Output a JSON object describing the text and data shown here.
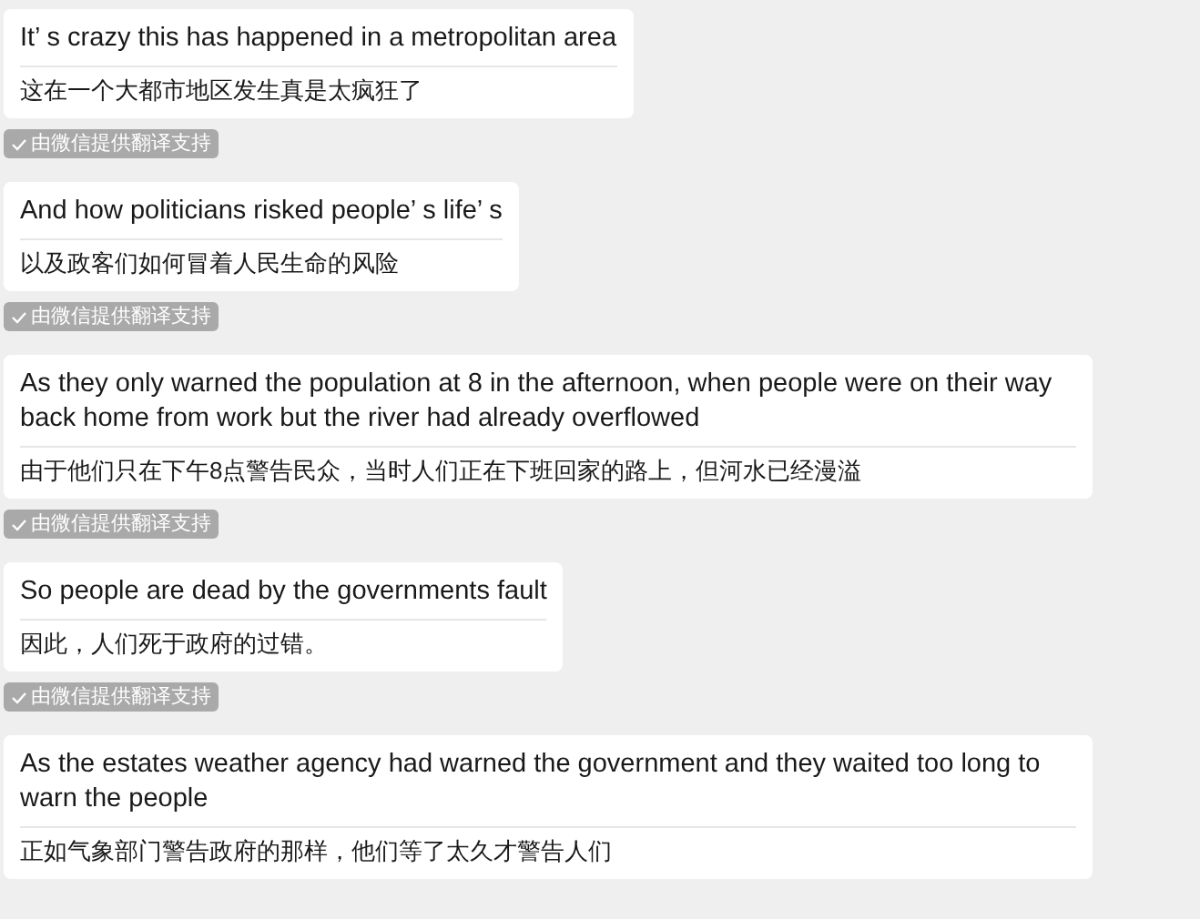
{
  "messages": [
    {
      "text": "It’ s crazy this has happened in a metropolitan area",
      "translation": "这在一个大都市地区发生真是太疯狂了",
      "badge": "由微信提供翻译支持"
    },
    {
      "text": "And how politicians risked people’ s life’ s",
      "translation": "以及政客们如何冒着人民生命的风险",
      "badge": "由微信提供翻译支持"
    },
    {
      "text": "As they only warned the population at 8 in the afternoon, when people were on their way back home from work but the river had already overflowed",
      "translation": "由于他们只在下午8点警告民众，当时人们正在下班回家的路上，但河水已经漫溢",
      "badge": "由微信提供翻译支持"
    },
    {
      "text": "So people are dead by the governments fault",
      "translation": "因此，人们死于政府的过错。",
      "badge": "由微信提供翻译支持"
    },
    {
      "text": "As the estates weather agency had warned the government and they waited too long to warn the people",
      "translation": "正如气象部门警告政府的那样，他们等了太久才警告人们"
    }
  ]
}
